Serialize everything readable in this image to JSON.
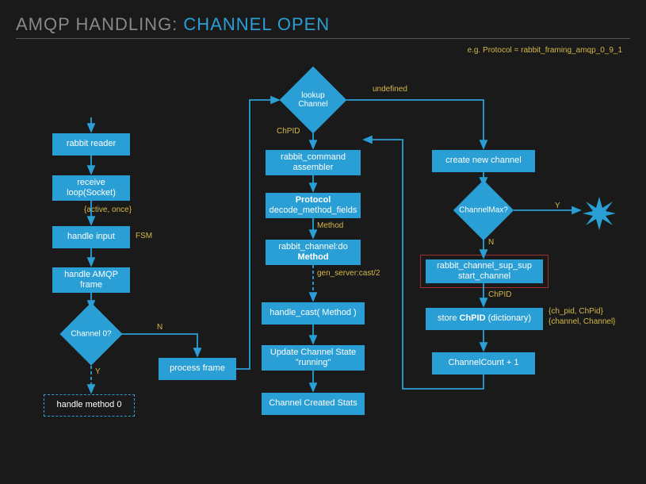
{
  "title": {
    "part1": "AMQP HANDLING: ",
    "part2": "CHANNEL OPEN"
  },
  "note": "e.g. Protocol = rabbit_framing_amqp_0_9_1",
  "col1": {
    "rabbit_reader": "rabbit reader",
    "receive_loop": "receive loop(Socket)",
    "active_once": "{active, once}",
    "handle_input": "handle input",
    "fsm": "FSM",
    "handle_amqp": "handle AMQP frame",
    "channel0": "Channel 0?",
    "y": "Y",
    "n": "N",
    "handle_method_0": "handle method 0",
    "process_frame": "process frame"
  },
  "col2": {
    "lookup_channel": "lookup Channel",
    "chpid": "ChPID",
    "undefined": "undefined",
    "rabbit_command_assembler": "rabbit_command assembler",
    "protocol_decode": "Protocol decode_method_fields",
    "method_label": "Method",
    "rabbit_channel_do": "rabbit_channel:do Method",
    "gen_server_cast": "gen_server:cast/2",
    "handle_cast": "handle_cast( Method )",
    "update_state": "Update Channel State \"running\"",
    "channel_created_stats": "Channel Created Stats"
  },
  "col3": {
    "create_new_channel": "create new channel",
    "channel_max": "ChannelMax?",
    "y": "Y",
    "n": "N",
    "sup_sup": "rabbit_channel_sup_sup start_channel",
    "chpid": "ChPID",
    "store_chpid": "store ChPID (dictionary)",
    "dict_note": "{ch_pid, ChPid} {channel, Channel}",
    "channel_count": "ChannelCount + 1"
  },
  "chart_data": {
    "type": "flowchart",
    "nodes": [
      {
        "id": "rabbit_reader",
        "label": "rabbit reader",
        "shape": "rect"
      },
      {
        "id": "receive_loop",
        "label": "receive loop(Socket)",
        "shape": "rect"
      },
      {
        "id": "handle_input",
        "label": "handle input",
        "shape": "rect",
        "note": "FSM"
      },
      {
        "id": "handle_amqp",
        "label": "handle AMQP frame",
        "shape": "rect"
      },
      {
        "id": "channel0",
        "label": "Channel 0?",
        "shape": "diamond"
      },
      {
        "id": "handle_method_0",
        "label": "handle method 0",
        "shape": "rect",
        "style": "dashed"
      },
      {
        "id": "process_frame",
        "label": "process frame",
        "shape": "rect"
      },
      {
        "id": "lookup_channel",
        "label": "lookup Channel",
        "shape": "diamond"
      },
      {
        "id": "rabbit_command_assembler",
        "label": "rabbit_command assembler",
        "shape": "rect"
      },
      {
        "id": "protocol_decode",
        "label": "Protocol decode_method_fields",
        "shape": "rect"
      },
      {
        "id": "rabbit_channel_do",
        "label": "rabbit_channel:do Method",
        "shape": "rect"
      },
      {
        "id": "handle_cast",
        "label": "handle_cast( Method )",
        "shape": "rect"
      },
      {
        "id": "update_state",
        "label": "Update Channel State \"running\"",
        "shape": "rect"
      },
      {
        "id": "channel_created_stats",
        "label": "Channel Created Stats",
        "shape": "rect"
      },
      {
        "id": "create_new_channel",
        "label": "create new channel",
        "shape": "rect"
      },
      {
        "id": "channel_max",
        "label": "ChannelMax?",
        "shape": "diamond"
      },
      {
        "id": "sup_sup",
        "label": "rabbit_channel_sup_sup start_channel",
        "shape": "rect",
        "highlight": "red-frame"
      },
      {
        "id": "store_chpid",
        "label": "store ChPID (dictionary)",
        "shape": "rect"
      },
      {
        "id": "channel_count",
        "label": "ChannelCount + 1",
        "shape": "rect"
      },
      {
        "id": "starburst",
        "label": "",
        "shape": "starburst"
      }
    ],
    "edges": [
      {
        "from": "rabbit_reader",
        "to": "receive_loop"
      },
      {
        "from": "receive_loop",
        "to": "handle_input",
        "label": "{active, once}"
      },
      {
        "from": "handle_input",
        "to": "handle_amqp"
      },
      {
        "from": "handle_amqp",
        "to": "channel0"
      },
      {
        "from": "channel0",
        "to": "handle_method_0",
        "label": "Y",
        "style": "dashed"
      },
      {
        "from": "channel0",
        "to": "process_frame",
        "label": "N"
      },
      {
        "from": "process_frame",
        "to": "lookup_channel"
      },
      {
        "from": "lookup_channel",
        "to": "rabbit_command_assembler",
        "label": "ChPID"
      },
      {
        "from": "lookup_channel",
        "to": "create_new_channel",
        "label": "undefined"
      },
      {
        "from": "rabbit_command_assembler",
        "to": "protocol_decode"
      },
      {
        "from": "protocol_decode",
        "to": "rabbit_channel_do",
        "label": "Method"
      },
      {
        "from": "rabbit_channel_do",
        "to": "handle_cast",
        "label": "gen_server:cast/2",
        "style": "dashed"
      },
      {
        "from": "handle_cast",
        "to": "update_state"
      },
      {
        "from": "update_state",
        "to": "channel_created_stats"
      },
      {
        "from": "create_new_channel",
        "to": "channel_max"
      },
      {
        "from": "channel_max",
        "to": "starburst",
        "label": "Y"
      },
      {
        "from": "channel_max",
        "to": "sup_sup",
        "label": "N"
      },
      {
        "from": "sup_sup",
        "to": "store_chpid",
        "label": "ChPID"
      },
      {
        "from": "store_chpid",
        "to": "channel_count"
      },
      {
        "from": "channel_count",
        "to": "lookup_channel",
        "note": "back to ChPID branch"
      }
    ]
  }
}
